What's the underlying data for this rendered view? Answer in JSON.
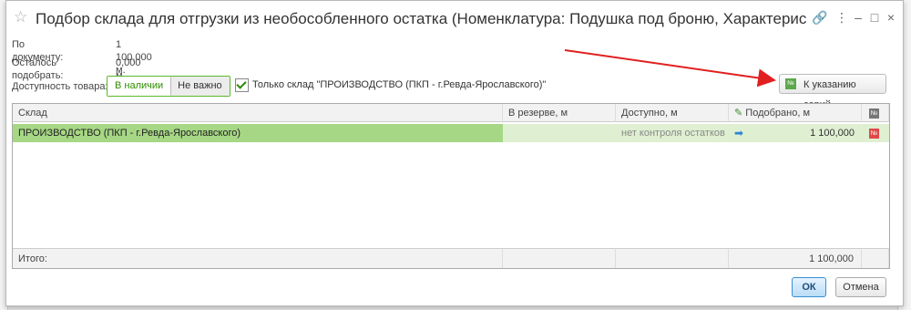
{
  "window": {
    "title": "Подбор склада для отгрузки из необособленного остатка (Номенклатура: Подушка под броню, Характеристи…",
    "controls": {
      "link": "🔗",
      "more": "⋮",
      "minimize": "–",
      "maximize": "□",
      "close": "×"
    }
  },
  "info": {
    "by_document_label": "По документу:",
    "by_document_value": "1 100,000 м.",
    "remaining_label": "Осталось подобрать:",
    "remaining_value": "0,000 м."
  },
  "availability": {
    "label": "Доступность товара:",
    "options": [
      "В наличии",
      "Не важно"
    ],
    "selected": "В наличии"
  },
  "only_warehouse": {
    "checked": true,
    "label": "Только склад \"ПРОИЗВОДСТВО (ПКП - г.Ревда-Ярославского)\""
  },
  "series_button": {
    "label": "К указанию серий",
    "icon_text": "№"
  },
  "table": {
    "columns": [
      "Склад",
      "В резерве, м",
      "Доступно, м",
      "Подобрано, м",
      "№"
    ],
    "rows": [
      {
        "warehouse": "ПРОИЗВОДСТВО (ПКП - г.Ревда-Ярославского)",
        "reserved": "",
        "available": "нет контроля остатков",
        "picked": "1 100,000",
        "badge": "№"
      }
    ],
    "footer": {
      "label": "Итого:",
      "picked_total": "1 100,000"
    }
  },
  "buttons": {
    "ok": "ОК",
    "cancel": "Отмена"
  },
  "colors": {
    "selected_row": "#a6d785",
    "selected_row_light": "#dff0d2",
    "accent_green": "#5cb82a",
    "arrow_red": "#e02020"
  }
}
